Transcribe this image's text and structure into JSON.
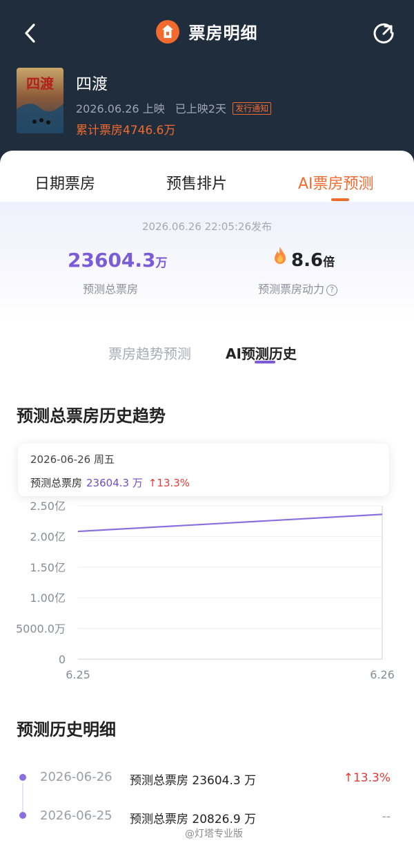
{
  "nav": {
    "title": "票房明细"
  },
  "movie": {
    "poster_text": "四渡",
    "name": "四渡",
    "release_date": "2026.06.26 上映",
    "days_released": "已上映2天",
    "notice_tag": "发行通知",
    "total_box_office": "累计票房4746.6万"
  },
  "tabs": [
    "日期票房",
    "预售排片",
    "AI票房预测"
  ],
  "summary": {
    "release_time": "2026.06.26 22:05:26发布",
    "predicted_value": "23604.3",
    "predicted_unit": "万",
    "predicted_label": "预测总票房",
    "power_value": "8.6",
    "power_unit": "倍",
    "power_label": "预测票房动力",
    "help_glyph": "?"
  },
  "subtabs": [
    "票房趋势预测",
    "AI预测历史"
  ],
  "trend": {
    "title": "预测总票房历史趋势",
    "tooltip": {
      "date": "2026-06-26  周五",
      "label": "预测总票房",
      "value": "23604.3 万",
      "change": "↑13.3%"
    }
  },
  "chart_data": {
    "type": "line",
    "x": [
      "6.25",
      "6.26"
    ],
    "series": [
      {
        "values": [
          20826.9,
          23604.3
        ]
      }
    ],
    "y_ticks": [
      "2.50亿",
      "2.00亿",
      "1.50亿",
      "1.00亿",
      "5000.0万",
      "0"
    ],
    "ylim": [
      0,
      25000
    ],
    "grid": true,
    "line_color": "#8a6fe0"
  },
  "history": {
    "title": "预测历史明细",
    "rows": [
      {
        "date": "2026-06-26",
        "desc": "预测总票房 23604.3 万",
        "change": "↑13.3%"
      },
      {
        "date": "2026-06-25",
        "desc": "预测总票房 20826.9 万",
        "change": "--"
      }
    ]
  },
  "watermark": "@灯塔专业版",
  "colors": {
    "header_bg": "#1f2d3d",
    "accent": "#f26a2e",
    "purple": "#7b5bd6",
    "red": "#e53935"
  }
}
